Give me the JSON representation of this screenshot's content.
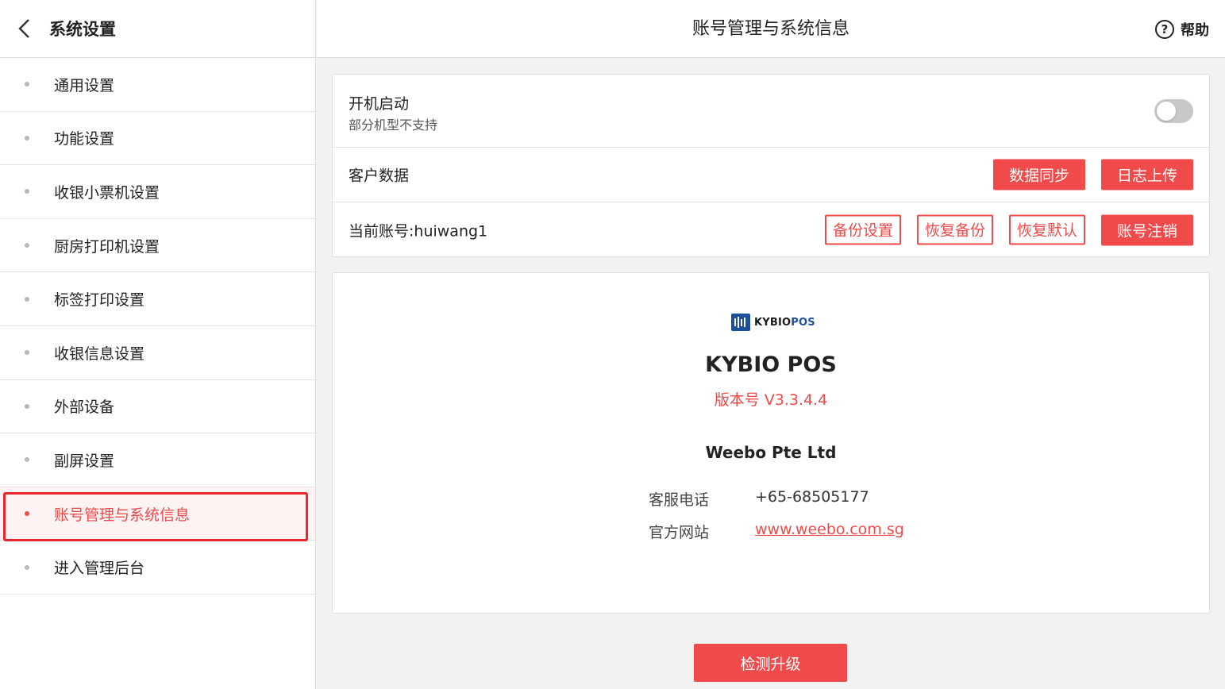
{
  "sidebar": {
    "title": "系统设置",
    "items": [
      {
        "label": "通用设置"
      },
      {
        "label": "功能设置"
      },
      {
        "label": "收银小票机设置"
      },
      {
        "label": "厨房打印机设置"
      },
      {
        "label": "标签打印设置"
      },
      {
        "label": "收银信息设置"
      },
      {
        "label": "外部设备"
      },
      {
        "label": "副屏设置"
      },
      {
        "label": "账号管理与系统信息",
        "active": true
      },
      {
        "label": "进入管理后台"
      }
    ]
  },
  "header": {
    "title": "账号管理与系统信息",
    "help_label": "帮助"
  },
  "settings": {
    "boot": {
      "label": "开机启动",
      "sub": "部分机型不支持",
      "enabled": false
    },
    "customer_data": {
      "label": "客户数据",
      "sync_label": "数据同步",
      "log_upload_label": "日志上传"
    },
    "account": {
      "label": "当前账号:huiwang1",
      "backup_settings_label": "备份设置",
      "restore_backup_label": "恢复备份",
      "restore_default_label": "恢复默认",
      "logout_label": "账号注销"
    }
  },
  "about": {
    "logo_text_a": "KYBIO",
    "logo_text_b": "POS",
    "app_name": "KYBIO POS",
    "version_label": "版本号",
    "version": "V3.3.4.4",
    "company": "Weebo Pte Ltd",
    "phone_label": "客服电话",
    "phone": "+65-68505177",
    "website_label": "官方网站",
    "website": "www.weebo.com.sg"
  },
  "upgrade_label": "检测升级",
  "colors": {
    "accent": "#f04a4a",
    "outline": "#e8262b",
    "brand_blue": "#1d4f9b"
  }
}
